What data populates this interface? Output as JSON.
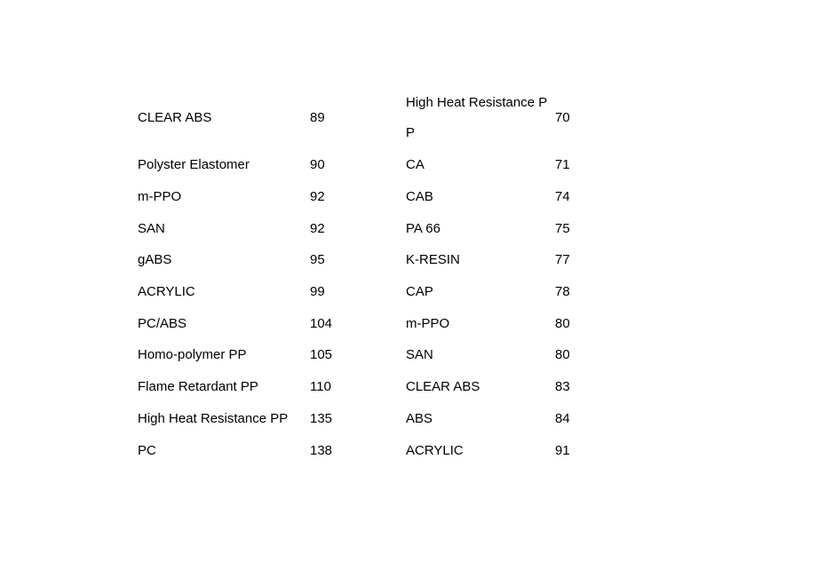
{
  "left_table": {
    "rows": [
      {
        "name": "CLEAR ABS",
        "value": "89"
      },
      {
        "name": "Polyster Elastomer",
        "value": "90"
      },
      {
        "name": "m-PPO",
        "value": "92"
      },
      {
        "name": "SAN",
        "value": "92"
      },
      {
        "name": "gABS",
        "value": "95"
      },
      {
        "name": "ACRYLIC",
        "value": "99"
      },
      {
        "name": "PC/ABS",
        "value": "104"
      },
      {
        "name": "Homo-polymer PP",
        "value": "105"
      },
      {
        "name": "Flame Retardant PP",
        "value": "110"
      },
      {
        "name": "High Heat Resistance PP",
        "value": "135"
      },
      {
        "name": "PC",
        "value": "138"
      }
    ]
  },
  "right_table": {
    "rows": [
      {
        "name_line1": "High Heat Resistance P",
        "name_line2": "P",
        "value": "70"
      },
      {
        "name": "CA",
        "value": "71"
      },
      {
        "name": "CAB",
        "value": "74"
      },
      {
        "name": "PA 66",
        "value": "75"
      },
      {
        "name": "K-RESIN",
        "value": "77"
      },
      {
        "name": "CAP",
        "value": "78"
      },
      {
        "name": "m-PPO",
        "value": "80"
      },
      {
        "name": "SAN",
        "value": "80"
      },
      {
        "name": "CLEAR ABS",
        "value": "83"
      },
      {
        "name": "ABS",
        "value": "84"
      },
      {
        "name": "ACRYLIC",
        "value": "91"
      }
    ]
  }
}
